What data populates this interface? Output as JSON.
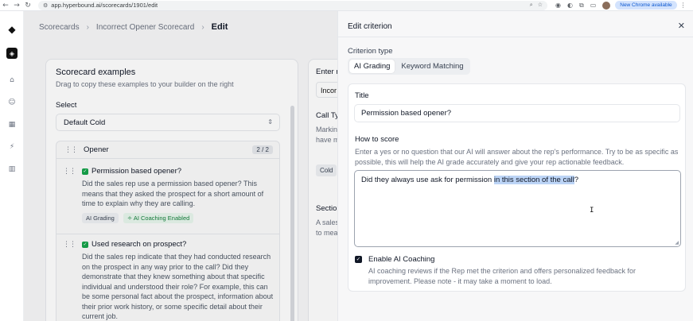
{
  "browser": {
    "url": "app.hyperbound.ai/scorecards/1901/edit",
    "new_chrome": "New Chrome available"
  },
  "breadcrumb": {
    "items": [
      "Scorecards",
      "Incorrect Opener Scorecard",
      "Edit"
    ]
  },
  "examples": {
    "title": "Scorecard examples",
    "subtitle": "Drag to copy these examples to your builder on the right",
    "select_label": "Select",
    "select_value": "Default Cold",
    "group_name": "Opener",
    "group_count": "2 / 2",
    "criteria": [
      {
        "name": "Permission based opener?",
        "description": "Did the sales rep use a permission based opener? This means that they asked the prospect for a short amount of time to explain why they are calling.",
        "tags": [
          "AI Grading",
          "AI Coaching Enabled"
        ]
      },
      {
        "name": "Used research on prospect?",
        "description": "Did the sales rep indicate that they had conducted research on the prospect in any way prior to the call? Did they demonstrate that they knew something about that specific individual and understood their role? For example, this can be some personal fact about the prospect, information about their prior work history, or some specific detail about their current job."
      }
    ]
  },
  "builder": {
    "name_label": "Enter n",
    "name_value": "Incor",
    "call_type_label": "Call Ty",
    "call_type_help_1": "Markin",
    "call_type_help_2": "have m",
    "cold_chip": "Cold",
    "section_label": "Section",
    "section_help_1": "A sales",
    "section_help_2": "to mea"
  },
  "drawer": {
    "title": "Edit criterion",
    "criterion_type_label": "Criterion type",
    "type_options": [
      "AI Grading",
      "Keyword Matching"
    ],
    "active_type": "AI Grading",
    "title_label": "Title",
    "title_value": "Permission based opener?",
    "how_label": "How to score",
    "how_help": "Enter a yes or no question that our AI will answer about the rep's performance. Try to be as specific as possible, this will help the AI grade accurately and give your rep actionable feedback.",
    "how_value_plain": "Did they always use ask for permission ",
    "how_value_selected": "in this section of the call",
    "how_value_end": "?",
    "coaching_label": "Enable AI Coaching",
    "coaching_checked": true,
    "coaching_help": "AI coaching reviews if the Rep met the criterion and offers personalized feedback for improvement. Please note - it may take a moment to load."
  }
}
